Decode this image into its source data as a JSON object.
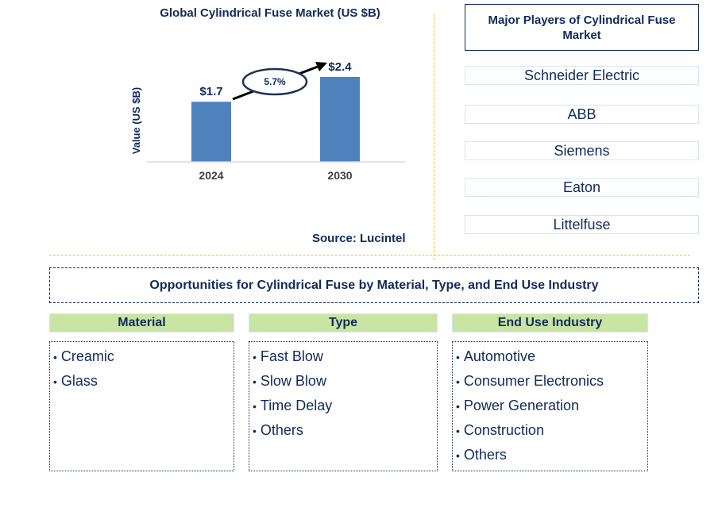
{
  "chart_data": {
    "type": "bar",
    "title": "Global Cylindrical Fuse Market (US $B)",
    "xlabel": "",
    "ylabel": "Value (US $B)",
    "categories": [
      "2024",
      "2030"
    ],
    "values": [
      1.7,
      2.4
    ],
    "data_labels": [
      "$1.7",
      "$2.4"
    ],
    "ylim": [
      0,
      2.4
    ],
    "grid": false,
    "bar_color": "#4f81bd",
    "annotation": {
      "text": "5.7%",
      "meaning": "CAGR 2024-2030"
    }
  },
  "source": "Source: Lucintel",
  "players": {
    "title": "Major Players of Cylindrical Fuse Market",
    "items": [
      "Schneider Electric",
      "ABB",
      "Siemens",
      "Eaton",
      "Littelfuse"
    ]
  },
  "opportunities": {
    "title": "Opportunities for Cylindrical Fuse by Material, Type, and End Use Industry",
    "categories": [
      {
        "header": "Material",
        "items": [
          "Creamic",
          "Glass"
        ]
      },
      {
        "header": "Type",
        "items": [
          "Fast Blow",
          "Slow Blow",
          "Time Delay",
          "Others"
        ]
      },
      {
        "header": "End Use Industry",
        "items": [
          "Automotive",
          "Consumer Electronics",
          "Power Generation",
          "Construction",
          "Others"
        ]
      }
    ]
  },
  "colors": {
    "text": "#0f2b5b",
    "bar": "#4f81bd",
    "header_fill": "#c9e4a3",
    "divider": "#f1c232",
    "player_border": "#d4e6f3"
  }
}
